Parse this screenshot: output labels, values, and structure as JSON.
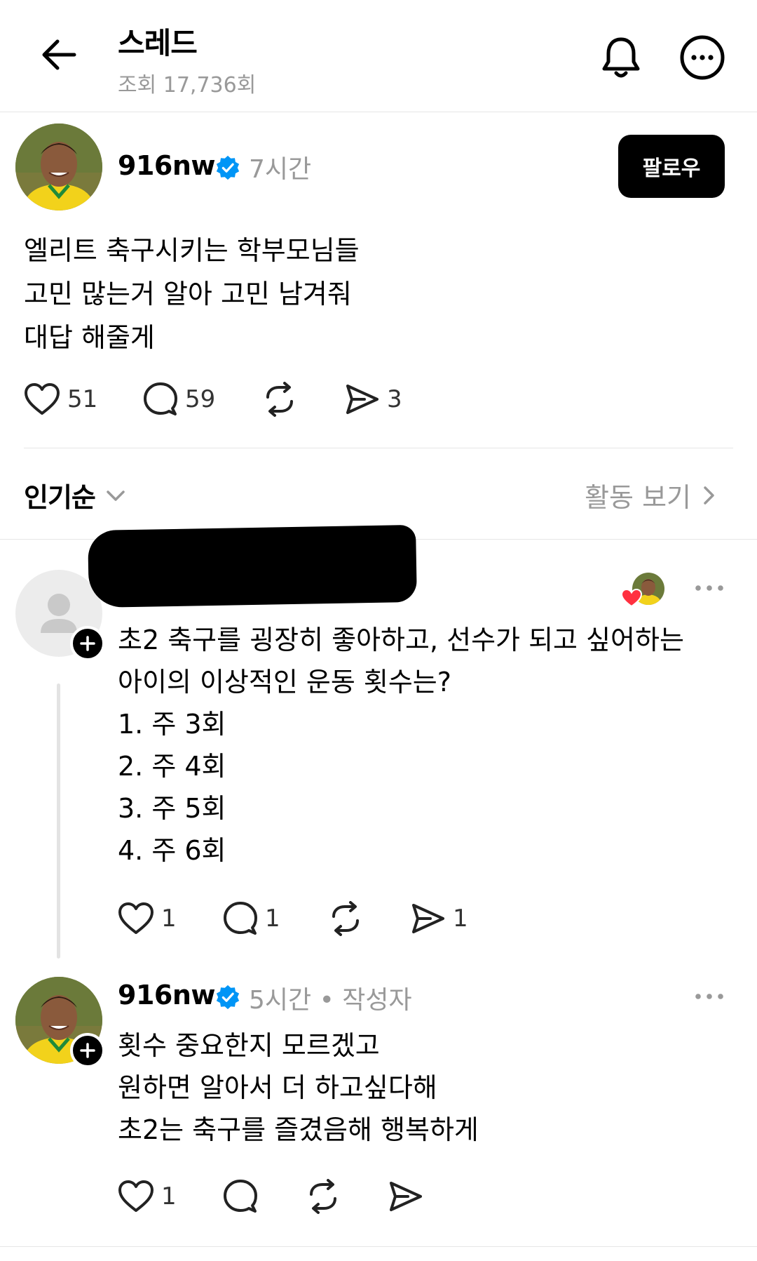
{
  "header": {
    "title": "스레드",
    "views": "조회 17,736회"
  },
  "post": {
    "author": "916nw",
    "time": "7시간",
    "follow_label": "팔로우",
    "text_lines": [
      "엘리트 축구시키는 학부모님들",
      "고민 많는거 알아 고민 남겨줘",
      "대답 해줄게"
    ],
    "likes": "51",
    "comments": "59",
    "shares": "3"
  },
  "sort": {
    "label": "인기순",
    "activity_label": "활동 보기"
  },
  "comment1": {
    "text_lines": [
      "초2 축구를 굉장히 좋아하고, 선수가 되고 싶어하는",
      "아이의 이상적인 운동 횟수는?",
      "1. 주 3회",
      "2. 주 4회",
      "3. 주 5회",
      "4. 주 6회"
    ],
    "likes": "1",
    "comments": "1",
    "shares": "1"
  },
  "comment2": {
    "author": "916nw",
    "time": "5시간 • 작성자",
    "text_lines": [
      "횟수 중요한지 모르겠고",
      "원하면 알아서 더 하고싶다해",
      "초2는 축구를 즐겼음해 행복하게"
    ],
    "likes": "1"
  },
  "icons": [
    "back-arrow-icon",
    "bell-icon",
    "more-icon",
    "verified-icon",
    "heart-icon",
    "comment-icon",
    "repost-icon",
    "share-icon",
    "chevron-down-icon",
    "chevron-right-icon",
    "plus-icon",
    "person-icon"
  ],
  "colors": {
    "accent": "#0095f6",
    "muted": "#999999",
    "like_red": "#ff3040"
  }
}
